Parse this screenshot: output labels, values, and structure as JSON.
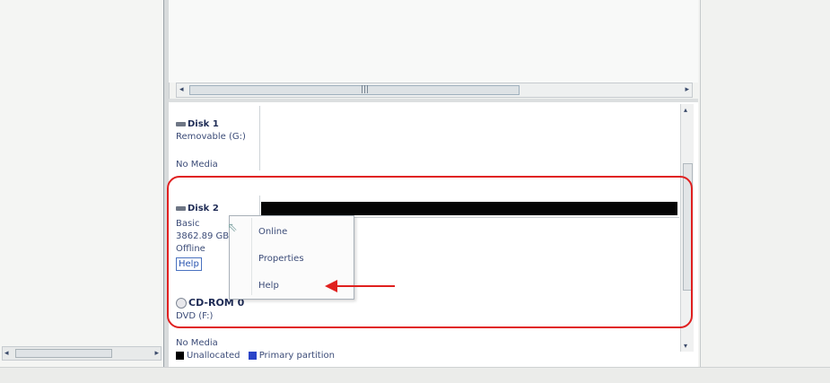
{
  "disk1": {
    "title": "Disk 1",
    "type": "Removable (G:)",
    "media": "No Media"
  },
  "disk2": {
    "title": "Disk 2",
    "basic": "Basic",
    "size": "3862.89 GB",
    "status": "Offline",
    "help": "Help"
  },
  "context_menu": {
    "online": "Online",
    "properties": "Properties",
    "help": "Help"
  },
  "cdrom": {
    "title": "CD-ROM 0",
    "type": "DVD (F:)",
    "media": "No Media"
  },
  "legend": {
    "unallocated": "Unallocated",
    "primary": "Primary partition"
  },
  "colors": {
    "annotation": "#e0201e",
    "unallocated": "#000000",
    "primary_partition": "#2a44c8"
  }
}
